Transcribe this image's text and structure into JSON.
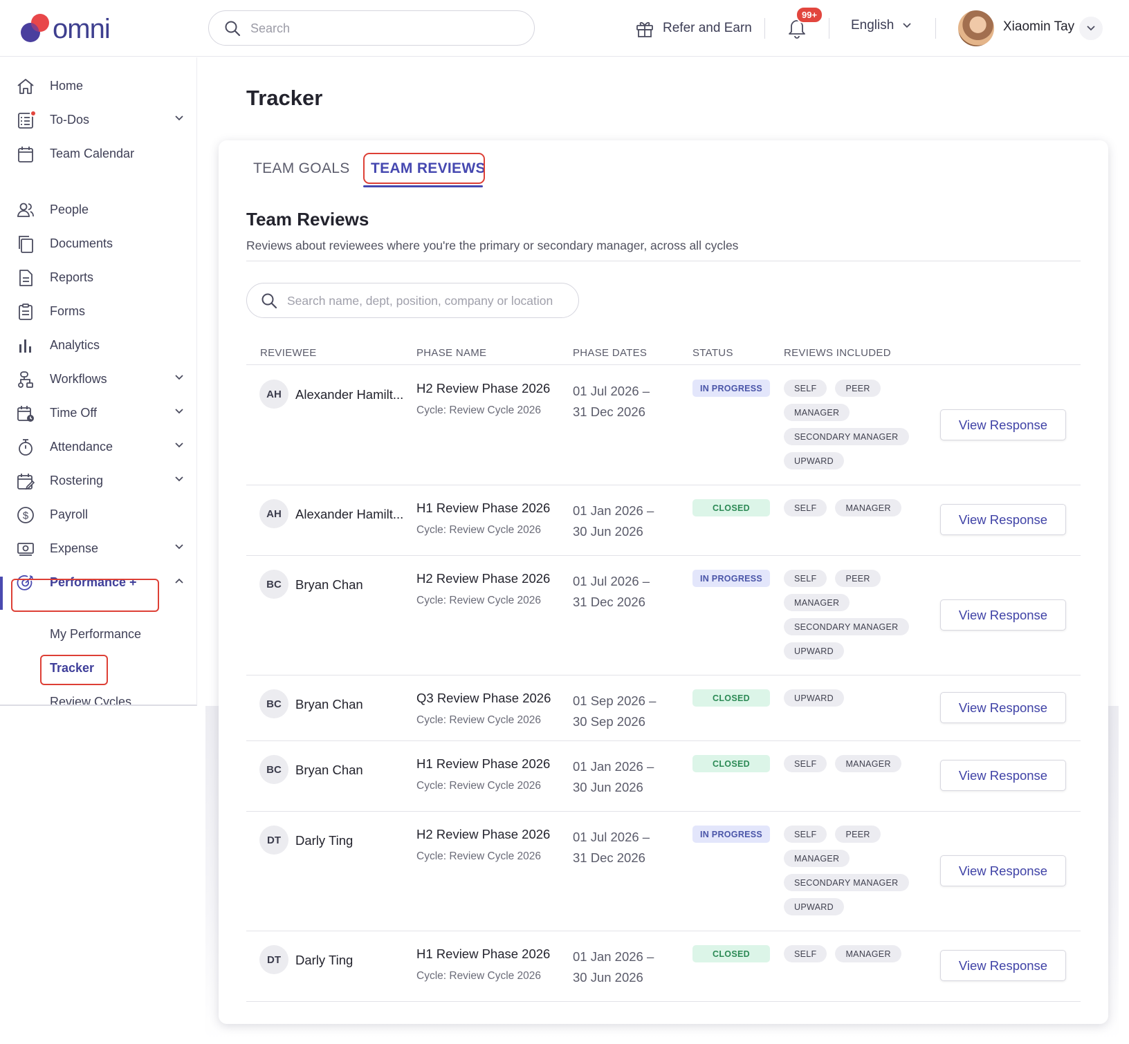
{
  "header": {
    "brand": "omni",
    "search_placeholder": "Search",
    "refer_label": "Refer and Earn",
    "notif_badge": "99+",
    "language": "English",
    "user_name": "Xiaomin Tay"
  },
  "sidebar": {
    "home": "Home",
    "todos": "To-Dos",
    "team_calendar": "Team Calendar",
    "people": "People",
    "documents": "Documents",
    "reports": "Reports",
    "forms": "Forms",
    "analytics": "Analytics",
    "workflows": "Workflows",
    "time_off": "Time Off",
    "attendance": "Attendance",
    "rostering": "Rostering",
    "payroll": "Payroll",
    "expense": "Expense",
    "performance": "Performance +",
    "my_performance": "My Performance",
    "tracker": "Tracker",
    "review_cycles": "Review Cycles"
  },
  "page": {
    "title": "Tracker",
    "tabs": [
      "TEAM GOALS",
      "TEAM REVIEWS"
    ],
    "section_title": "Team Reviews",
    "section_desc": "Reviews about reviewees where you're the primary or secondary manager, across all cycles",
    "search_placeholder": "Search name, dept, position, company or location"
  },
  "table": {
    "headers": [
      "REVIEWEE",
      "PHASE NAME",
      "PHASE DATES",
      "STATUS",
      "REVIEWS INCLUDED"
    ],
    "action_label": "View Response",
    "rows": [
      {
        "initials": "AH",
        "name": "Alexander Hamilt...",
        "phase": "H2 Review Phase 2026",
        "cycle": "Cycle: Review Cycle 2026",
        "date_start": "01 Jul 2026 –",
        "date_end": "31 Dec 2026",
        "status": "IN PROGRESS",
        "status_type": "inprogress",
        "tags": [
          "SELF",
          "PEER",
          "MANAGER",
          "SECONDARY MANAGER",
          "UPWARD"
        ]
      },
      {
        "initials": "AH",
        "name": "Alexander Hamilt...",
        "phase": "H1 Review Phase 2026",
        "cycle": "Cycle: Review Cycle 2026",
        "date_start": "01 Jan 2026 –",
        "date_end": "30 Jun 2026",
        "status": "CLOSED",
        "status_type": "closed",
        "tags": [
          "SELF",
          "MANAGER"
        ]
      },
      {
        "initials": "BC",
        "name": "Bryan Chan",
        "phase": "H2 Review Phase 2026",
        "cycle": "Cycle: Review Cycle 2026",
        "date_start": "01 Jul 2026 –",
        "date_end": "31 Dec 2026",
        "status": "IN PROGRESS",
        "status_type": "inprogress",
        "tags": [
          "SELF",
          "PEER",
          "MANAGER",
          "SECONDARY MANAGER",
          "UPWARD"
        ]
      },
      {
        "initials": "BC",
        "name": "Bryan Chan",
        "phase": "Q3 Review Phase 2026",
        "cycle": "Cycle: Review Cycle 2026",
        "date_start": "01 Sep 2026 –",
        "date_end": "30 Sep 2026",
        "status": "CLOSED",
        "status_type": "closed",
        "tags": [
          "UPWARD"
        ]
      },
      {
        "initials": "BC",
        "name": "Bryan Chan",
        "phase": "H1 Review Phase 2026",
        "cycle": "Cycle: Review Cycle 2026",
        "date_start": "01 Jan 2026 –",
        "date_end": "30 Jun 2026",
        "status": "CLOSED",
        "status_type": "closed",
        "tags": [
          "SELF",
          "MANAGER"
        ]
      },
      {
        "initials": "DT",
        "name": "Darly Ting",
        "phase": "H2 Review Phase 2026",
        "cycle": "Cycle: Review Cycle 2026",
        "date_start": "01 Jul 2026 –",
        "date_end": "31 Dec 2026",
        "status": "IN PROGRESS",
        "status_type": "inprogress",
        "tags": [
          "SELF",
          "PEER",
          "MANAGER",
          "SECONDARY MANAGER",
          "UPWARD"
        ]
      },
      {
        "initials": "DT",
        "name": "Darly Ting",
        "phase": "H1 Review Phase 2026",
        "cycle": "Cycle: Review Cycle 2026",
        "date_start": "01 Jan 2026 –",
        "date_end": "30 Jun 2026",
        "status": "CLOSED",
        "status_type": "closed",
        "tags": [
          "SELF",
          "MANAGER"
        ]
      }
    ]
  }
}
